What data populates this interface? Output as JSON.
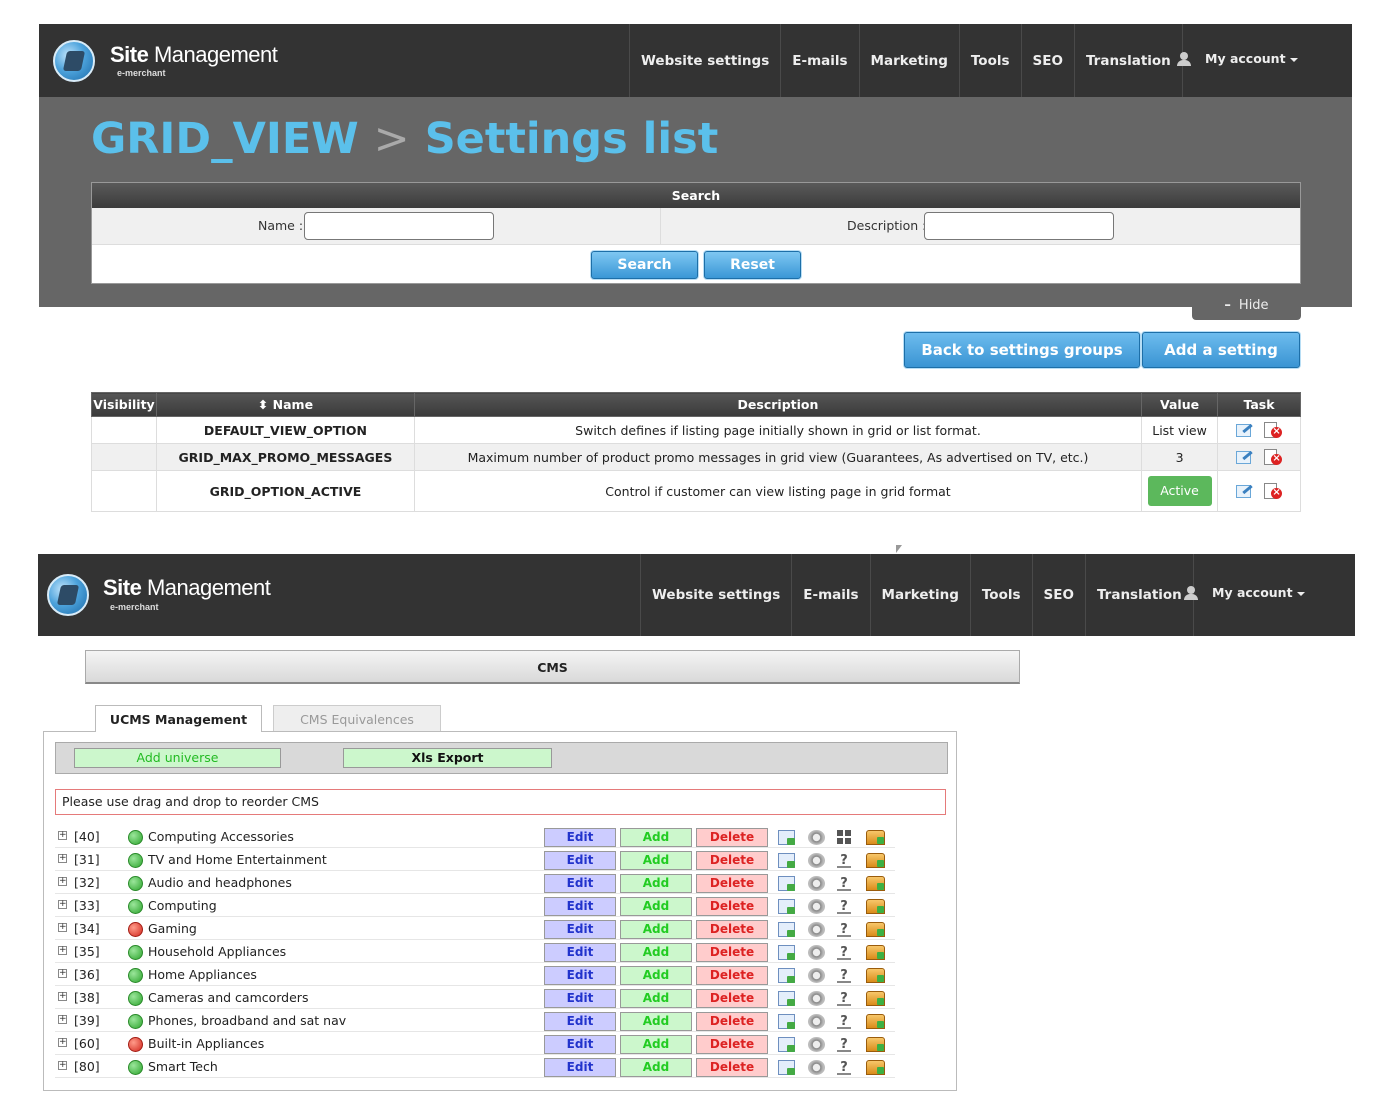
{
  "header": {
    "brand_strong": "Site",
    "brand_rest": " Management",
    "brand_sub": "e-merchant",
    "nav": [
      "Website settings",
      "E-mails",
      "Marketing",
      "Tools",
      "SEO",
      "Translation"
    ],
    "account": "My account"
  },
  "settings_page": {
    "title_main": "GRID_VIEW",
    "title_sep": ">",
    "title_sub": "Settings list",
    "search": {
      "heading": "Search",
      "name_label": "Name :",
      "description_label": "Description :",
      "name_value": "",
      "description_value": "",
      "search_button": "Search",
      "reset_button": "Reset",
      "hide_label": "Hide"
    },
    "back_button": "Back to settings groups",
    "add_button": "Add a setting",
    "table": {
      "headers": [
        "Visibility",
        "Name",
        "Description",
        "Value",
        "Task"
      ],
      "rows": [
        {
          "visibility": "",
          "name": "DEFAULT_VIEW_OPTION",
          "description": "Switch defines if listing page initially shown in grid or list format.",
          "value": "List view"
        },
        {
          "visibility": "",
          "name": "GRID_MAX_PROMO_MESSAGES",
          "description": "Maximum number of product promo messages in grid view (Guarantees, As advertised on TV, etc.)",
          "value": "3"
        },
        {
          "visibility": "",
          "name": "GRID_OPTION_ACTIVE",
          "description": "Control if customer can view listing page in grid format",
          "value": "Active"
        }
      ]
    }
  },
  "cms_page": {
    "bar_title": "CMS",
    "tabs": [
      "UCMS Management",
      "CMS Equivalences"
    ],
    "add_universe": "Add universe",
    "xls_export": "Xls Export",
    "notice": "Please use drag and drop to reorder CMS",
    "row_buttons": {
      "edit": "Edit",
      "add": "Add",
      "delete": "Delete"
    },
    "items": [
      {
        "id": "[40]",
        "label": "Computing Accessories",
        "status": "green",
        "third_icon": "grid-icon"
      },
      {
        "id": "[31]",
        "label": "TV and Home Entertainment",
        "status": "green",
        "third_icon": "question-icon"
      },
      {
        "id": "[32]",
        "label": "Audio and headphones",
        "status": "green",
        "third_icon": "question-icon"
      },
      {
        "id": "[33]",
        "label": "Computing",
        "status": "green",
        "third_icon": "question-icon"
      },
      {
        "id": "[34]",
        "label": "Gaming",
        "status": "red",
        "third_icon": "question-icon"
      },
      {
        "id": "[35]",
        "label": "Household Appliances",
        "status": "green",
        "third_icon": "question-icon"
      },
      {
        "id": "[36]",
        "label": "Home Appliances",
        "status": "green",
        "third_icon": "question-icon"
      },
      {
        "id": "[38]",
        "label": "Cameras and camcorders",
        "status": "green",
        "third_icon": "question-icon"
      },
      {
        "id": "[39]",
        "label": "Phones, broadband and sat nav",
        "status": "green",
        "third_icon": "question-icon"
      },
      {
        "id": "[60]",
        "label": "Built-in Appliances",
        "status": "red",
        "third_icon": "question-icon"
      },
      {
        "id": "[80]",
        "label": "Smart Tech",
        "status": "green",
        "third_icon": "question-icon"
      }
    ]
  },
  "colors": {
    "topbar": "#333333",
    "title_blue": "#5bc0eb",
    "button_blue": "#3a97d6",
    "active_green": "#5cb85c"
  }
}
